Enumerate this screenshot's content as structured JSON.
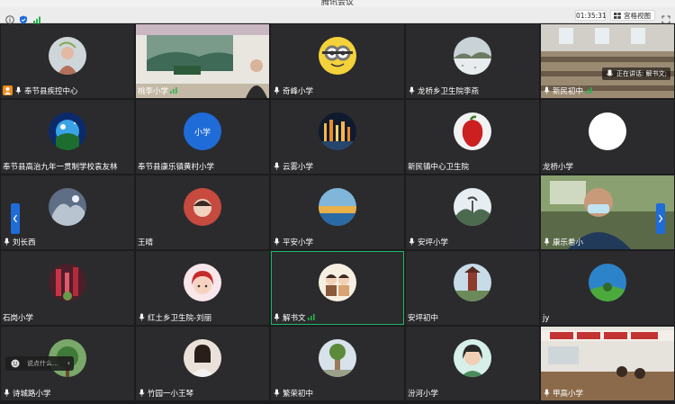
{
  "window": {
    "title": "腾讯会议"
  },
  "toolbar": {
    "timer": "01:35:31",
    "view_label": "宫格视图"
  },
  "speaking": {
    "text": "正在讲话: 解书文;"
  },
  "chat": {
    "placeholder": "说点什么..."
  },
  "tiles": [
    {
      "name": "奉节县疾控中心",
      "mic": true,
      "owner": true
    },
    {
      "name": "桃李小学",
      "mic": false,
      "signal": true
    },
    {
      "name": "奇峰小学",
      "mic": true
    },
    {
      "name": "龙桥乡卫生院李燕",
      "mic": true
    },
    {
      "name": "新民初中",
      "mic": true,
      "signal": true
    },
    {
      "name": "奉节县高治九年一贯制学校袁友林",
      "mic": false
    },
    {
      "name": "奉节县康乐镇黄村小学",
      "mic": false,
      "avatar_text": "小学"
    },
    {
      "name": "云雾小学",
      "mic": true
    },
    {
      "name": "新民镇中心卫生院",
      "mic": false
    },
    {
      "name": "龙桥小学",
      "mic": false
    },
    {
      "name": "刘长西",
      "mic": true
    },
    {
      "name": "王晴",
      "mic": false
    },
    {
      "name": "平安小学",
      "mic": true
    },
    {
      "name": "安坪小学",
      "mic": true
    },
    {
      "name": "康乐希小",
      "mic": true
    },
    {
      "name": "石岗小学",
      "mic": false
    },
    {
      "name": "红土乡卫生院-刘丽",
      "mic": true
    },
    {
      "name": "解书文",
      "mic": true,
      "signal": true,
      "active": true
    },
    {
      "name": "安坪初中",
      "mic": false
    },
    {
      "name": "jy",
      "mic": false
    },
    {
      "name": "诗城路小学",
      "mic": true
    },
    {
      "name": "竹园一小王琴",
      "mic": true
    },
    {
      "name": "繁荣初中",
      "mic": true
    },
    {
      "name": "汾河小学",
      "mic": false
    },
    {
      "name": "甲高小学",
      "mic": true
    }
  ]
}
